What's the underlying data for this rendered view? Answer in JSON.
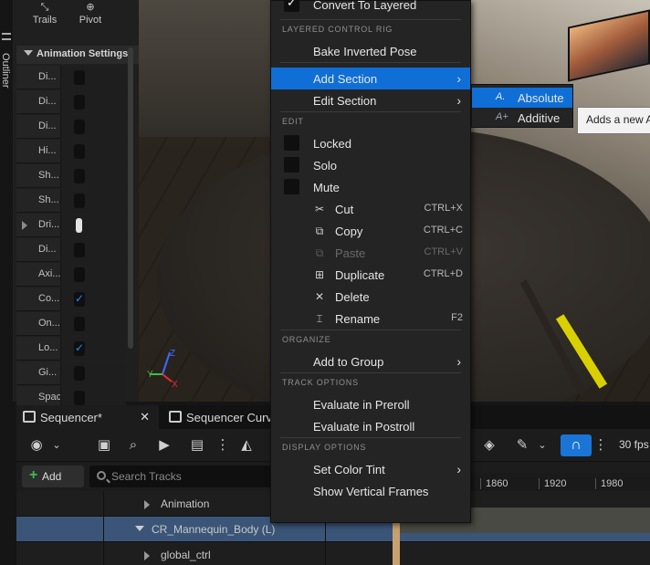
{
  "left_panel": {
    "outliner_label": "Outliner",
    "tools": [
      {
        "label": "Trails",
        "icon": "trails-icon"
      },
      {
        "label": "Pivot",
        "icon": "pivot-icon"
      }
    ],
    "section_title": "Animation Settings",
    "rows": [
      {
        "label": "Di...",
        "control": "box",
        "checked": false
      },
      {
        "label": "Di...",
        "control": "box",
        "checked": false
      },
      {
        "label": "Di...",
        "control": "box",
        "checked": false
      },
      {
        "label": "Hi...",
        "control": "box",
        "checked": false
      },
      {
        "label": "Sh...",
        "control": "box",
        "checked": false
      },
      {
        "label": "Sh...",
        "control": "box",
        "checked": false
      },
      {
        "label": "Dri...",
        "control": "white",
        "checked": false,
        "expandable": true
      },
      {
        "label": "Di...",
        "control": "box",
        "checked": false
      },
      {
        "label": "Axi...",
        "control": "box",
        "checked": false
      },
      {
        "label": "Co...",
        "control": "box",
        "checked": true
      },
      {
        "label": "On...",
        "control": "box",
        "checked": false
      },
      {
        "label": "Lo...",
        "control": "box",
        "checked": true
      },
      {
        "label": "Gi...",
        "control": "box",
        "checked": false
      },
      {
        "label": "Spaces",
        "control": "box",
        "checked": false
      }
    ]
  },
  "gizmo": {
    "y_label": "Y",
    "z_label": "Z",
    "x_label": "X"
  },
  "context_menu": {
    "top_item": {
      "label": "Convert To Layered",
      "checked": true
    },
    "sections": [
      {
        "title": "LAYERED CONTROL RIG",
        "items": [
          {
            "label": "Bake Inverted Pose"
          }
        ]
      },
      {
        "title": "",
        "items": [
          {
            "label": "Add Section",
            "submenu": true,
            "highlighted": true
          },
          {
            "label": "Edit Section",
            "submenu": true
          }
        ]
      },
      {
        "title": "EDIT",
        "items": [
          {
            "label": "Locked",
            "checkbox": true,
            "checked": false
          },
          {
            "label": "Solo",
            "checkbox": true,
            "checked": false
          },
          {
            "label": "Mute",
            "checkbox": true,
            "checked": false
          },
          {
            "label": "Cut",
            "icon": "cut-icon",
            "shortcut": "CTRL+X"
          },
          {
            "label": "Copy",
            "icon": "copy-icon",
            "shortcut": "CTRL+C"
          },
          {
            "label": "Paste",
            "icon": "paste-icon",
            "shortcut": "CTRL+V",
            "disabled": true
          },
          {
            "label": "Duplicate",
            "icon": "duplicate-icon",
            "shortcut": "CTRL+D"
          },
          {
            "label": "Delete",
            "icon": "delete-icon"
          },
          {
            "label": "Rename",
            "icon": "rename-icon",
            "shortcut": "F2"
          }
        ]
      },
      {
        "title": "ORGANIZE",
        "items": [
          {
            "label": "Add to Group",
            "submenu": true
          }
        ]
      },
      {
        "title": "TRACK OPTIONS",
        "items": [
          {
            "label": "Evaluate in Preroll"
          },
          {
            "label": "Evaluate in Postroll"
          }
        ]
      },
      {
        "title": "DISPLAY OPTIONS",
        "items": [
          {
            "label": "Set Color Tint",
            "submenu": true
          },
          {
            "label": "Show Vertical Frames"
          }
        ]
      }
    ]
  },
  "submenu": {
    "items": [
      {
        "label": "Absolute",
        "icon": "absolute-blend-icon",
        "glyph": "A.",
        "highlighted": true
      },
      {
        "label": "Additive",
        "icon": "additive-blend-icon",
        "glyph": "A+"
      }
    ]
  },
  "tooltip": {
    "text": "Adds a new A"
  },
  "sequencer": {
    "tabs": [
      {
        "label": "Sequencer*",
        "closable": true,
        "active": true
      },
      {
        "label": "Sequencer Curv",
        "closable": false,
        "active": false
      }
    ],
    "add_label": "Add",
    "search_placeholder": "Search Tracks",
    "fps": "30 fps",
    "ruler_ticks": [
      "1860",
      "1920",
      "1980"
    ],
    "tracks": [
      {
        "name": "Animation",
        "expand": "right",
        "indent": 158
      },
      {
        "name": "CR_Mannequin_Body (L)",
        "expand": "down",
        "indent": 148,
        "selected": true
      },
      {
        "name": "global_ctrl",
        "expand": "right",
        "indent": 158
      }
    ]
  },
  "colors": {
    "accent": "#0f6fd6",
    "selection_row": "#3a5578",
    "checkbox_checked": "#1e8cff",
    "add_plus": "#3fb950",
    "chair_yellow": "#d8d000"
  }
}
